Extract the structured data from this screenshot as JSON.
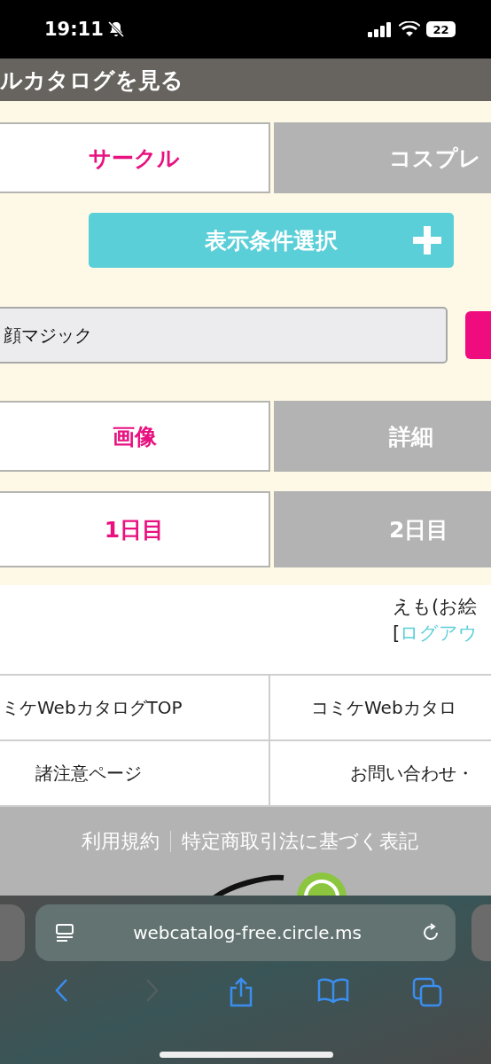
{
  "status_bar": {
    "time": "19:11",
    "battery": "22"
  },
  "header": {
    "title": "ルカタログを見る"
  },
  "category_tabs": [
    {
      "label": "サークル",
      "selected": true
    },
    {
      "label": "コスプレ",
      "selected": false
    }
  ],
  "filter_button": {
    "label": "表示条件選択"
  },
  "search": {
    "value": "顔マジック"
  },
  "view_tabs": [
    {
      "label": "画像",
      "selected": true
    },
    {
      "label": "詳細",
      "selected": false
    }
  ],
  "day_tabs": [
    {
      "label": "1日目",
      "selected": true
    },
    {
      "label": "2日目",
      "selected": false
    }
  ],
  "user": {
    "name": "えも(お絵",
    "prefix": "[",
    "link": "ログアウ"
  },
  "links": [
    {
      "label": "ミケWebカタログTOP"
    },
    {
      "label": "コミケWebカタロ"
    },
    {
      "label": "諸注意ページ"
    },
    {
      "label": "お問い合わせ・"
    }
  ],
  "footer_links": [
    "利用規約",
    "特定商取引法に基づく表記"
  ],
  "browser": {
    "url": "webcatalog-free.circle.ms"
  }
}
